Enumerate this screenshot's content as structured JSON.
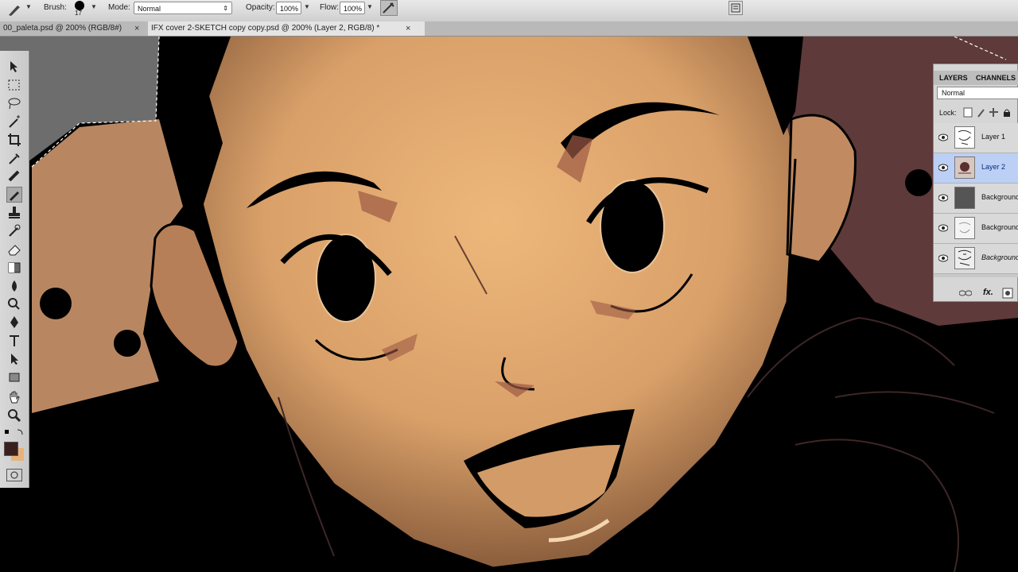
{
  "options_bar": {
    "brush_label": "Brush:",
    "brush_size": "17",
    "mode_label": "Mode:",
    "mode_value": "Normal",
    "opacity_label": "Opacity:",
    "opacity_value": "100%",
    "flow_label": "Flow:",
    "flow_value": "100%"
  },
  "tabs": [
    {
      "label": "00_paleta.psd @ 200% (RGB/8#)",
      "close": "×"
    },
    {
      "label": "IFX cover 2-SKETCH copy copy.psd @ 200% (Layer 2, RGB/8) *",
      "close": "×"
    }
  ],
  "toolbox": {
    "tools": [
      "move-icon",
      "marquee-icon",
      "lasso-icon",
      "magic-wand-icon",
      "crop-icon",
      "eyedropper-icon",
      "healing-icon",
      "brush-icon",
      "stamp-icon",
      "history-brush-icon",
      "eraser-icon",
      "gradient-icon",
      "blur-icon",
      "dodge-icon",
      "pen-icon",
      "type-icon",
      "path-select-icon",
      "shape-icon",
      "hand-icon",
      "zoom-icon"
    ],
    "foreground_color": "#3b1f1f",
    "background_color": "#e7b27a"
  },
  "layers_panel": {
    "tab_layers": "LAYERS",
    "tab_channels": "CHANNELS",
    "blend_mode": "Normal",
    "lock_label": "Lock:",
    "layers": [
      {
        "name": "Layer 1",
        "selected": false
      },
      {
        "name": "Layer 2",
        "selected": true
      },
      {
        "name": "Background",
        "selected": false
      },
      {
        "name": "Background",
        "selected": false
      },
      {
        "name": "Background",
        "selected": false
      }
    ],
    "footer_fx": "fx."
  },
  "colors": {
    "skin": "#e0a86c",
    "line": "#050505",
    "blush": "#9c5a45",
    "selected_layer": "#bcd0f5"
  }
}
